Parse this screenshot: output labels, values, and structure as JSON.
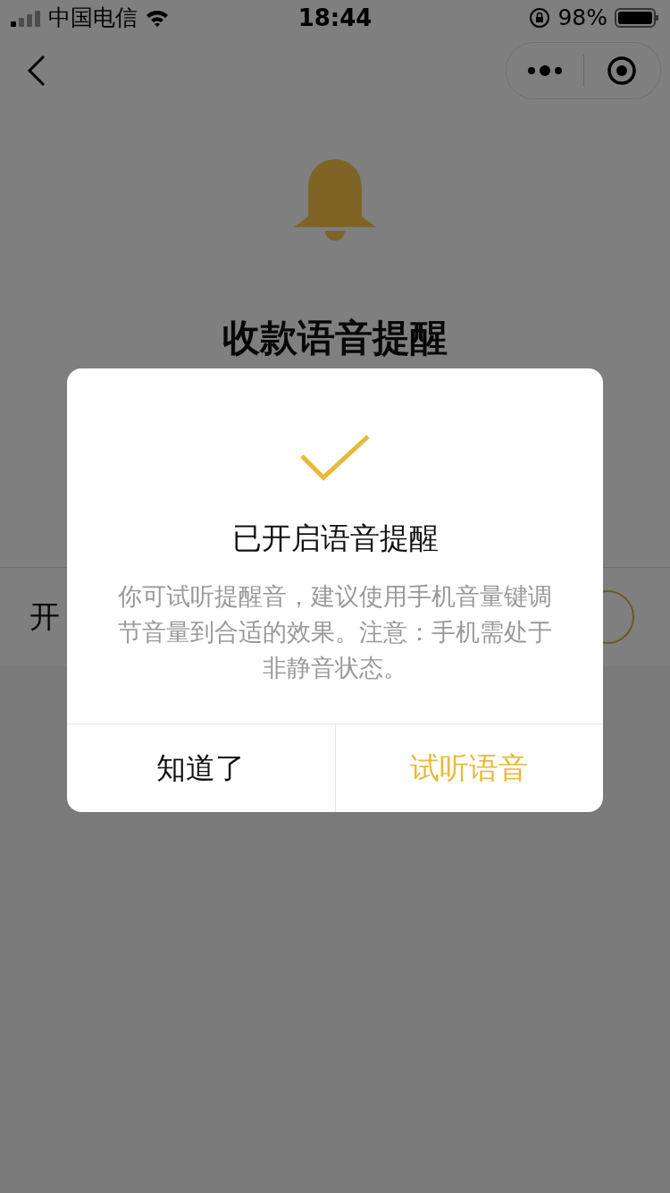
{
  "status_bar": {
    "carrier": "中国电信",
    "time": "18:44",
    "battery": "98%"
  },
  "page": {
    "title": "收款语音提醒",
    "setting_row": {
      "label": "开"
    }
  },
  "dialog": {
    "title": "已开启语音提醒",
    "message": "你可试听提醒音，建议使用手机音量键调节音量到合适的效果。注意：手机需处于非静音状态。",
    "buttons": [
      {
        "label": "知道了",
        "kind": "plain"
      },
      {
        "label": "试听语音",
        "kind": "accent"
      }
    ]
  }
}
